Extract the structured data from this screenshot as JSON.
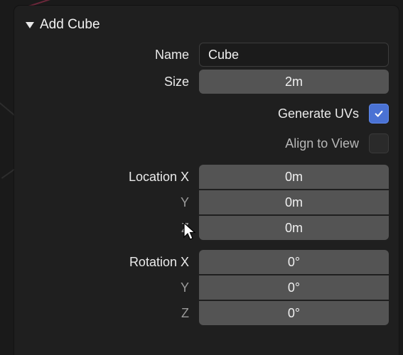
{
  "panel": {
    "title": "Add Cube"
  },
  "name": {
    "label": "Name",
    "value": "Cube"
  },
  "size": {
    "label": "Size",
    "value": "2m"
  },
  "generate_uvs": {
    "label": "Generate UVs",
    "checked": true
  },
  "align_to_view": {
    "label": "Align to View",
    "checked": false
  },
  "location": {
    "label": "Location X",
    "label_y": "Y",
    "label_z": "Z",
    "x": "0m",
    "y": "0m",
    "z": "0m"
  },
  "rotation": {
    "label": "Rotation X",
    "label_y": "Y",
    "label_z": "Z",
    "x": "0°",
    "y": "0°",
    "z": "0°"
  }
}
